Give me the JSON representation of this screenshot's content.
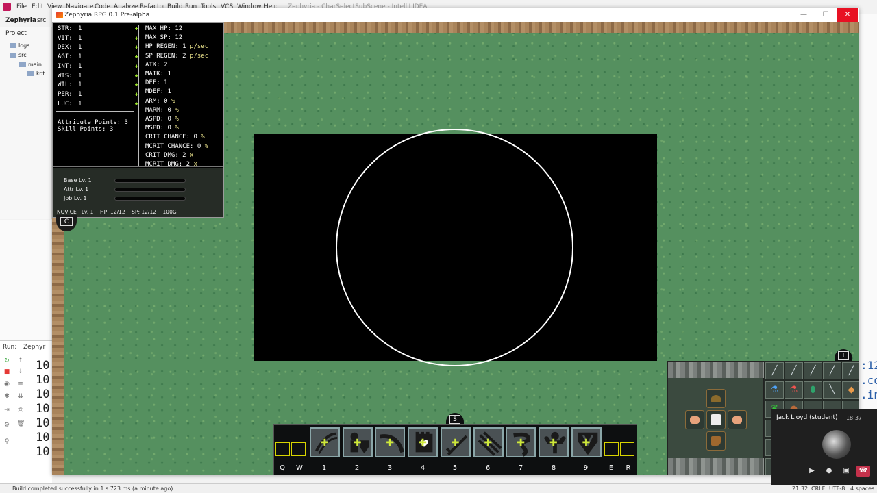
{
  "ide": {
    "menu": [
      "File",
      "Edit",
      "View",
      "Navigate",
      "Code",
      "Analyze",
      "Refactor",
      "Build",
      "Run",
      "Tools",
      "VCS",
      "Window",
      "Help"
    ],
    "window_title": "Zephyria - CharSelectSubScene - IntelliJ IDEA",
    "breadcrumb": [
      "Zephyria",
      "src"
    ],
    "project_label": "Project",
    "tree": [
      "logs",
      "src",
      "main",
      "kot"
    ],
    "run_label": "Run:",
    "run_tab": "Zephyr",
    "run_lines": [
      "10",
      "10",
      "10",
      "10",
      "10",
      "10",
      "10"
    ],
    "right_code": [
      ":12",
      ".co",
      ".in"
    ],
    "status_left": "Build completed successfully in 1 s 723 ms (a minute ago)",
    "status_right": [
      "21:32",
      "CRLF",
      "UTF-8",
      "4 spaces"
    ]
  },
  "game": {
    "window_title": "Zephyria RPG 0.1 Pre-alpha",
    "base_stats": [
      {
        "label": "STR:",
        "value": "1"
      },
      {
        "label": "VIT:",
        "value": "1"
      },
      {
        "label": "DEX:",
        "value": "1"
      },
      {
        "label": "AGI:",
        "value": "1"
      },
      {
        "label": "INT:",
        "value": "1"
      },
      {
        "label": "WIS:",
        "value": "1"
      },
      {
        "label": "WIL:",
        "value": "1"
      },
      {
        "label": "PER:",
        "value": "1"
      },
      {
        "label": "LUC:",
        "value": "1"
      }
    ],
    "plus_glyph": "✚",
    "attribute_points": "Attribute Points: 3",
    "skill_points": "Skill Points: 3",
    "derived_stats": [
      {
        "text": "MAX HP: 12",
        "unit": ""
      },
      {
        "text": "MAX SP: 12",
        "unit": ""
      },
      {
        "text": "HP REGEN: 1",
        "unit": "p/sec"
      },
      {
        "text": "SP REGEN: 2",
        "unit": "p/sec"
      },
      {
        "text": "ATK: 2",
        "unit": ""
      },
      {
        "text": "MATK: 1",
        "unit": ""
      },
      {
        "text": "DEF: 1",
        "unit": ""
      },
      {
        "text": "MDEF: 1",
        "unit": ""
      },
      {
        "text": "ARM: 0",
        "unit": "%"
      },
      {
        "text": "MARM: 0",
        "unit": "%"
      },
      {
        "text": "ASPD: 0",
        "unit": "%"
      },
      {
        "text": "MSPD: 0",
        "unit": "%"
      },
      {
        "text": "CRIT CHANCE: 0",
        "unit": "%"
      },
      {
        "text": "MCRIT CHANCE: 0",
        "unit": "%"
      },
      {
        "text": "CRIT DMG: 2",
        "unit": "x"
      },
      {
        "text": "MCRIT DMG: 2",
        "unit": "x"
      }
    ],
    "levels": [
      {
        "label": "Base Lv. 1",
        "progress": 0.0
      },
      {
        "label": "Attr Lv. 1",
        "progress": 0.0
      },
      {
        "label": "Job Lv. 1",
        "progress": 0.0
      }
    ],
    "summary": "NOVICE   Lv. 1    HP: 12/12    SP: 12/12    100G",
    "char_key": "C",
    "skill_key": "S",
    "inventory_key": "I",
    "skill_keys": [
      "Q",
      "W",
      "1",
      "2",
      "3",
      "4",
      "5",
      "6",
      "7",
      "8",
      "9",
      "E",
      "R"
    ],
    "skill_icons": [
      "slash-skill-icon",
      "knight-shield-skill-icon",
      "arc-skill-icon",
      "heart-tower-skill-icon",
      "sword-skill-icon",
      "claw-skill-icon",
      "tornado-skill-icon",
      "strongman-skill-icon",
      "shield-emblem-skill-icon"
    ],
    "equipment_icons": [
      "helmet-icon",
      "glove-left-icon",
      "shirt-icon",
      "glove-right-icon",
      "boot-icon"
    ],
    "inventory_icons": [
      "sword-item-icon",
      "sword-item-icon",
      "sword-item-icon",
      "sword-item-icon",
      "sword-item-icon",
      "blue-potion-icon",
      "red-potion-icon",
      "green-gem-icon",
      "dagger-item-icon",
      "bread-icon",
      "green-leaf-icon",
      "food-item-icon"
    ],
    "colors": {
      "grass": "#55905f",
      "plus": "#9be22a",
      "unit": "#e8e08a",
      "slot_border": "#d8d400"
    }
  },
  "call": {
    "name": "Jack Lloyd (student)",
    "time": "18:37"
  }
}
